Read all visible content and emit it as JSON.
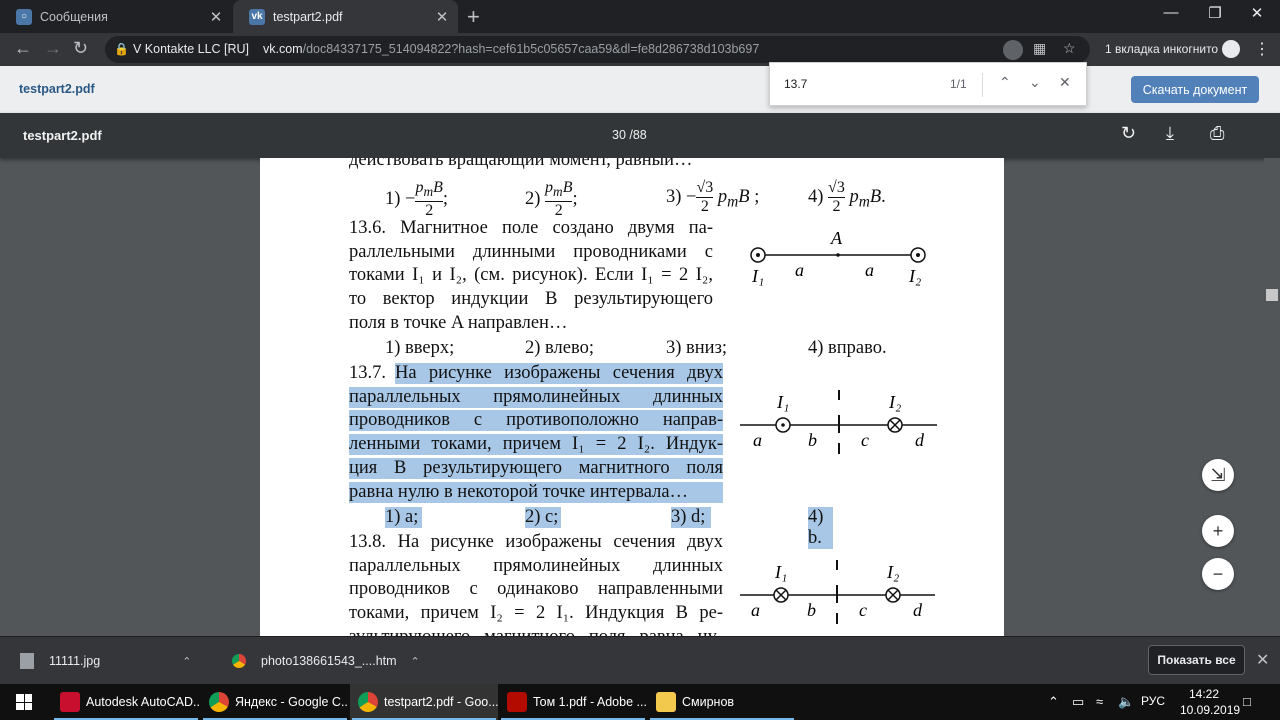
{
  "browser": {
    "tabs": [
      {
        "title": "Сообщения",
        "icon": "chat-icon"
      },
      {
        "title": "testpart2.pdf",
        "icon": "vk-icon"
      }
    ],
    "site_identity": "V Kontakte LLC [RU]",
    "url_host": "vk.com",
    "url_path": "/doc84337175_514094822?hash=cef61b5c05657caa59&dl=fe8d286738d103b697",
    "incognito_label": "1 вкладка инкогнито"
  },
  "vk": {
    "filename": "testpart2.pdf",
    "download_label": "Скачать документ"
  },
  "find": {
    "query": "13.7",
    "count": "1/1"
  },
  "pdf": {
    "title": "testpart2.pdf",
    "page_indicator": "30 /88"
  },
  "document": {
    "top_cut": "действовать вращающий момент, равный…",
    "q136_options": [
      "1) −",
      "2)",
      "3) −",
      "4)"
    ],
    "q136": {
      "number": "13.6.",
      "lines": [
        "13.6. Магнитное поле создано двумя па-",
        "раллельными длинными проводниками с",
        "токами I₁ и I₂, (см. рисунок). Если I₁ = 2 I₂,",
        "то вектор индукции B результирующего",
        "поля в точке A направлен…"
      ],
      "options": [
        "1) вверх;",
        "2) влево;",
        "3) вниз;",
        "4) вправо."
      ],
      "figure": {
        "top_label": "A",
        "left": "I₁",
        "right": "I₂",
        "seg1": "a",
        "seg2": "a"
      }
    },
    "q137": {
      "number": "13.7.",
      "lines": [
        "На рисунке изображены сечения двух",
        "параллельных прямолинейных длинных",
        "проводников с противоположно направ-",
        "ленными токами, причем I₁ = 2 I₂. Индук-",
        "ция B результирующего магнитного поля",
        "равна нулю в некоторой точке интервала…"
      ],
      "options": [
        "1) a;",
        "2) c;",
        "3) d;",
        "4) b."
      ],
      "figure": {
        "i1": "I₁",
        "i2": "I₂",
        "seg": [
          "a",
          "b",
          "c",
          "d"
        ]
      }
    },
    "q138": {
      "number": "13.8.",
      "lines": [
        "13.8. На рисунке изображены сечения двух",
        "параллельных прямолинейных длинных",
        "проводников с одинаково направленными",
        "токами, причем I₂ = 2 I₁. Индукция B ре-",
        "зультирующего магнитного поля равна ну-"
      ],
      "figure": {
        "i1": "I₁",
        "i2": "I₂",
        "seg": [
          "a",
          "b",
          "c",
          "d"
        ]
      }
    }
  },
  "downloads": [
    {
      "name": "11111.jpg"
    },
    {
      "name": "photo138661543_....htm"
    }
  ],
  "shelf": {
    "show_all": "Показать все"
  },
  "taskbar": {
    "items": [
      "Autodesk AutoCAD...",
      "Яндекс - Google C...",
      "testpart2.pdf - Goo...",
      "Том 1.pdf - Adobe ...",
      "Смирнов"
    ],
    "lang": "РУС",
    "time": "14:22",
    "date": "10.09.2019"
  },
  "colors": {
    "vk_blue": "#5181b8",
    "highlight": "#a8c7e6",
    "pdf_toolbar": "#323639"
  }
}
